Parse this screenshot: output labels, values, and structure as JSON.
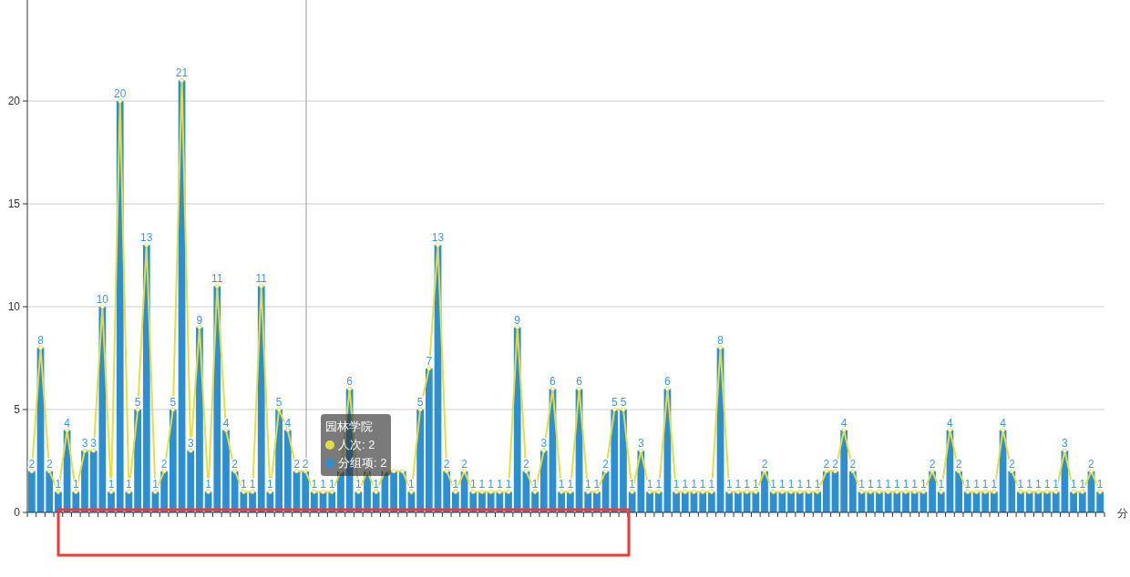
{
  "chart_data": {
    "type": "bar",
    "xlabel": "分",
    "ylim": [
      0,
      25
    ],
    "yticks": [
      0,
      5,
      10,
      15,
      20
    ],
    "grid": true,
    "series": [
      {
        "name": "人次",
        "type": "line",
        "marker": "circle",
        "color": "#e6de3f",
        "values": [
          2,
          8,
          2,
          1,
          4,
          1,
          3,
          3,
          10,
          1,
          20,
          1,
          5,
          13,
          1,
          2,
          5,
          21,
          3,
          9,
          1,
          11,
          4,
          2,
          1,
          1,
          11,
          1,
          5,
          4,
          2,
          2,
          1,
          1,
          1,
          2,
          6,
          1,
          2,
          1,
          2,
          2,
          2,
          1,
          5,
          7,
          13,
          2,
          1,
          2,
          1,
          1,
          1,
          1,
          1,
          9,
          2,
          1,
          3,
          6,
          1,
          1,
          6,
          1,
          1,
          2,
          5,
          5,
          1,
          3,
          1,
          1,
          6,
          1,
          1,
          1,
          1,
          1,
          8,
          1,
          1,
          1,
          1,
          2,
          1,
          1,
          1,
          1,
          1,
          1,
          2,
          2,
          4,
          2,
          1,
          1,
          1,
          1,
          1,
          1,
          1,
          1,
          2,
          1,
          4,
          2,
          1,
          1,
          1,
          1,
          4,
          2,
          1,
          1,
          1,
          1,
          1,
          3,
          1,
          1,
          2,
          1
        ]
      },
      {
        "name": "分组项",
        "color": "#2b8fd1",
        "values": [
          2,
          8,
          2,
          1,
          4,
          1,
          3,
          3,
          10,
          1,
          20,
          1,
          5,
          13,
          1,
          2,
          5,
          21,
          3,
          9,
          1,
          11,
          4,
          2,
          1,
          1,
          11,
          1,
          5,
          4,
          2,
          2,
          1,
          1,
          1,
          2,
          6,
          1,
          2,
          1,
          2,
          2,
          2,
          1,
          5,
          7,
          13,
          2,
          1,
          2,
          1,
          1,
          1,
          1,
          1,
          9,
          2,
          1,
          3,
          6,
          1,
          1,
          6,
          1,
          1,
          2,
          5,
          5,
          1,
          3,
          1,
          1,
          6,
          1,
          1,
          1,
          1,
          1,
          8,
          1,
          1,
          1,
          1,
          2,
          1,
          1,
          1,
          1,
          1,
          1,
          2,
          2,
          4,
          2,
          1,
          1,
          1,
          1,
          1,
          1,
          1,
          1,
          2,
          1,
          4,
          2,
          1,
          1,
          1,
          1,
          4,
          2,
          1,
          1,
          1,
          1,
          1,
          3,
          1,
          1,
          2,
          1
        ],
        "value_labels": [
          "2",
          "8",
          "2",
          "1",
          "4",
          "1",
          "3",
          "3",
          "10",
          "1",
          "20",
          "1",
          "5",
          "13",
          "1",
          "2",
          "5",
          "21",
          "3",
          "9",
          "1",
          "11",
          "4",
          "2",
          "1",
          "1",
          "11",
          "1",
          "5",
          "4",
          "2",
          "2",
          "1",
          "1",
          "1",
          null,
          "6",
          "1",
          null,
          "1",
          null,
          null,
          null,
          "1",
          "5",
          "7",
          "13",
          "2",
          "1",
          "2",
          "1",
          "1",
          "1",
          "1",
          "1",
          "9",
          "2",
          "1",
          "3",
          "6",
          "1",
          "1",
          "6",
          "1",
          "1",
          "2",
          "5",
          "5",
          "1",
          "3",
          "1",
          "1",
          "6",
          "1",
          "1",
          "1",
          "1",
          "1",
          "8",
          "1",
          "1",
          "1",
          "1",
          "2",
          "1",
          "1",
          "1",
          "1",
          "1",
          "1",
          "2",
          "2",
          "4",
          "2",
          "1",
          "1",
          "1",
          "1",
          "1",
          "1",
          "1",
          "1",
          "2",
          "1",
          "4",
          "2",
          "1",
          "1",
          "1",
          "1",
          "4",
          "2",
          "1",
          "1",
          "1",
          "1",
          "1",
          "3",
          "1",
          "1",
          "2",
          "1"
        ]
      }
    ]
  },
  "tooltip": {
    "title": "园林学院",
    "items": [
      {
        "value": ": 2"
      },
      {
        "value": ": 2"
      }
    ]
  }
}
